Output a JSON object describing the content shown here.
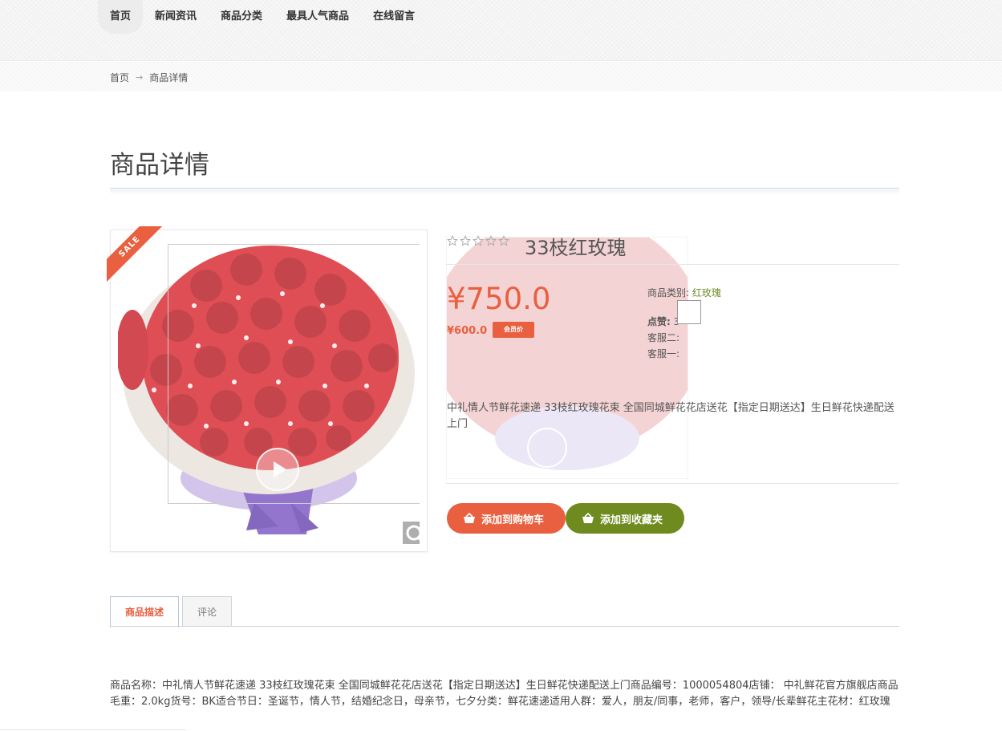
{
  "nav": {
    "items": [
      {
        "label": "首页",
        "active": true
      },
      {
        "label": "新闻资讯"
      },
      {
        "label": "商品分类"
      },
      {
        "label": "最具人气商品"
      },
      {
        "label": "在线留言"
      }
    ]
  },
  "breadcrumb": {
    "home": "首页",
    "current": "商品详情"
  },
  "page": {
    "title": "商品详情"
  },
  "product": {
    "sale_badge": "SALE",
    "name": "33枝红玫瑰",
    "rating": 0,
    "rating_max": 5,
    "price": "¥750.0",
    "member_price": "¥600.0",
    "member_badge": "会员价",
    "category_label": "商品类别:",
    "category_value": "红玫瑰",
    "likes_label": "点赞:",
    "likes_value": "3",
    "service2_label": "客服二:",
    "service1_label": "客服一:",
    "description": "中礼情人节鲜花速递 33枝红玫瑰花束 全国同城鲜花花店送花【指定日期送达】生日鲜花快递配送上门",
    "add_cart_label": "添加到购物车",
    "add_fav_label": "添加到收藏夹"
  },
  "tabs": [
    {
      "label": "商品描述",
      "active": true
    },
    {
      "label": "评论"
    }
  ],
  "tab_content": {
    "text": "商品名称：中礼情人节鲜花速递 33枝红玫瑰花束 全国同城鲜花花店送花【指定日期送达】生日鲜花快递配送上门商品编号：1000054804店铺： 中礼鲜花官方旗舰店商品毛重：2.0kg货号：BK适合节日：圣诞节，情人节，结婚纪念日，母亲节，七夕分类：鲜花速递适用人群：爱人，朋友/同事，老师，客户，领导/长辈鲜花主花材：红玫瑰"
  },
  "colors": {
    "accent": "#e8603f",
    "green": "#6f8b1f",
    "category_green": "#6b8e23"
  },
  "icons": [
    "sale-ribbon",
    "zoom-magnifier-icon",
    "play-icon",
    "star-icon",
    "basket-icon"
  ]
}
